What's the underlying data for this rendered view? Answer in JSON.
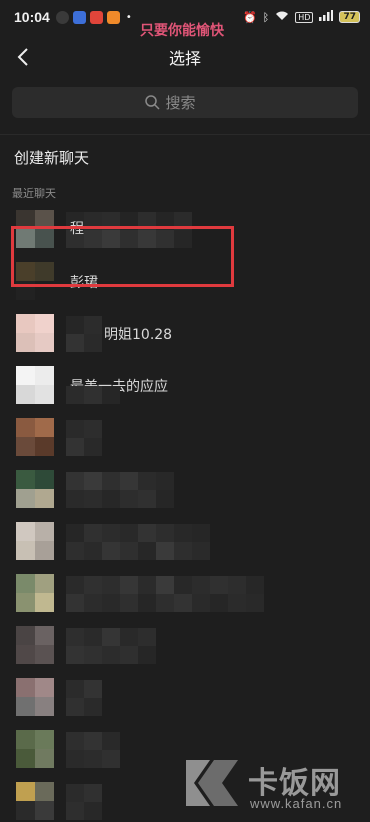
{
  "status_bar": {
    "time": "10:04",
    "hd_label": "HD",
    "battery": "77"
  },
  "watermark_caption": "只要你能愉快",
  "header": {
    "title": "选择"
  },
  "search": {
    "placeholder": "搜索"
  },
  "new_chat_label": "创建新聊天",
  "recent_label": "最近聊天",
  "rows": [
    {
      "name": "程"
    },
    {
      "name": "彭珺"
    },
    {
      "name": "明姐10.28"
    },
    {
      "name": "最美一去的应应"
    },
    {
      "name": ""
    },
    {
      "name": ""
    },
    {
      "name": ""
    },
    {
      "name": ""
    },
    {
      "name": ""
    },
    {
      "name": ""
    },
    {
      "name": ""
    },
    {
      "name": ""
    }
  ],
  "watermark_logo": {
    "brand": "卡饭网",
    "url": "www.kafan.cn"
  },
  "colors": {
    "background": "#1e1e1e",
    "highlight": "#e03a3e",
    "caption": "#e05577"
  }
}
